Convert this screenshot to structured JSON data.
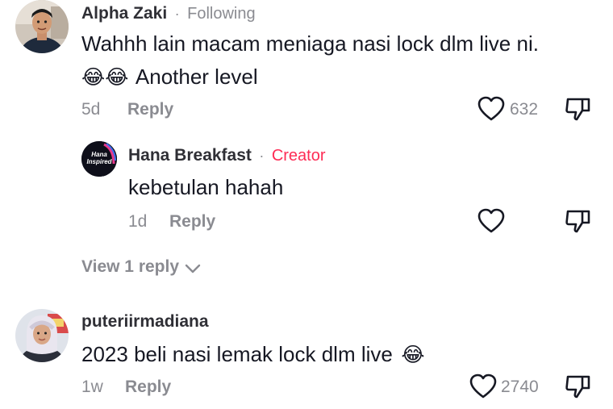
{
  "comments": [
    {
      "username": "Alpha Zaki",
      "tag": "Following",
      "text_line1": "Wahhh lain macam meniaga nasi lock dlm live ni.",
      "text_line2": "Another level",
      "emoji": "😂",
      "time": "5d",
      "reply_label": "Reply",
      "likes": "632",
      "replies": [
        {
          "username": "Hana Breakfast",
          "tag": "Creator",
          "avatar_text_1": "Hana",
          "avatar_text_2": "Inspired",
          "text": "kebetulan hahah",
          "time": "1d",
          "reply_label": "Reply"
        }
      ],
      "view_replies_label": "View 1 reply"
    },
    {
      "username": "puteriirmadiana",
      "text": "2023 beli nasi lemak lock dlm live",
      "emoji": "😂",
      "time": "1w",
      "reply_label": "Reply",
      "likes": "2740"
    }
  ],
  "icons": {
    "heart": "heart-outline-icon",
    "dislike": "thumbs-down-icon",
    "expand": "chevron-down-icon"
  },
  "colors": {
    "creator_tag": "#fe2c55",
    "muted": "#8a8b91",
    "text": "#161823"
  }
}
